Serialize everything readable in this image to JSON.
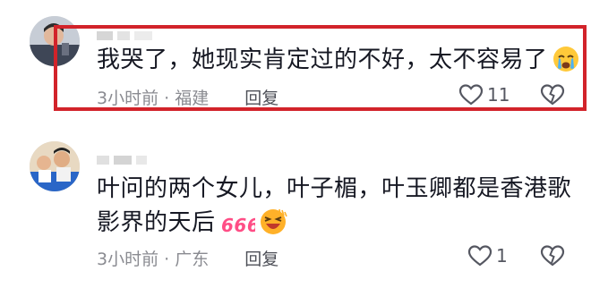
{
  "comments": [
    {
      "text": "我哭了，她现实肯定过的不好，太不容易了",
      "emoji": "crying-face",
      "time": "3小时前",
      "separator": "·",
      "location": "福建",
      "reply_label": "回复",
      "like_count": "11",
      "highlighted": true
    },
    {
      "text_line1": "叶问的两个女儿，叶子楣，叶玉卿都是香港歌",
      "text_line2": "影界的天后",
      "sticker_text": "666",
      "emoji": "laughing-face",
      "time": "3小时前",
      "separator": "·",
      "location": "广东",
      "reply_label": "回复",
      "like_count": "1",
      "highlighted": false
    }
  ],
  "colors": {
    "highlight_border": "#d2232a",
    "meta_text": "#8a8b91",
    "sticker": "#ff4e86"
  }
}
